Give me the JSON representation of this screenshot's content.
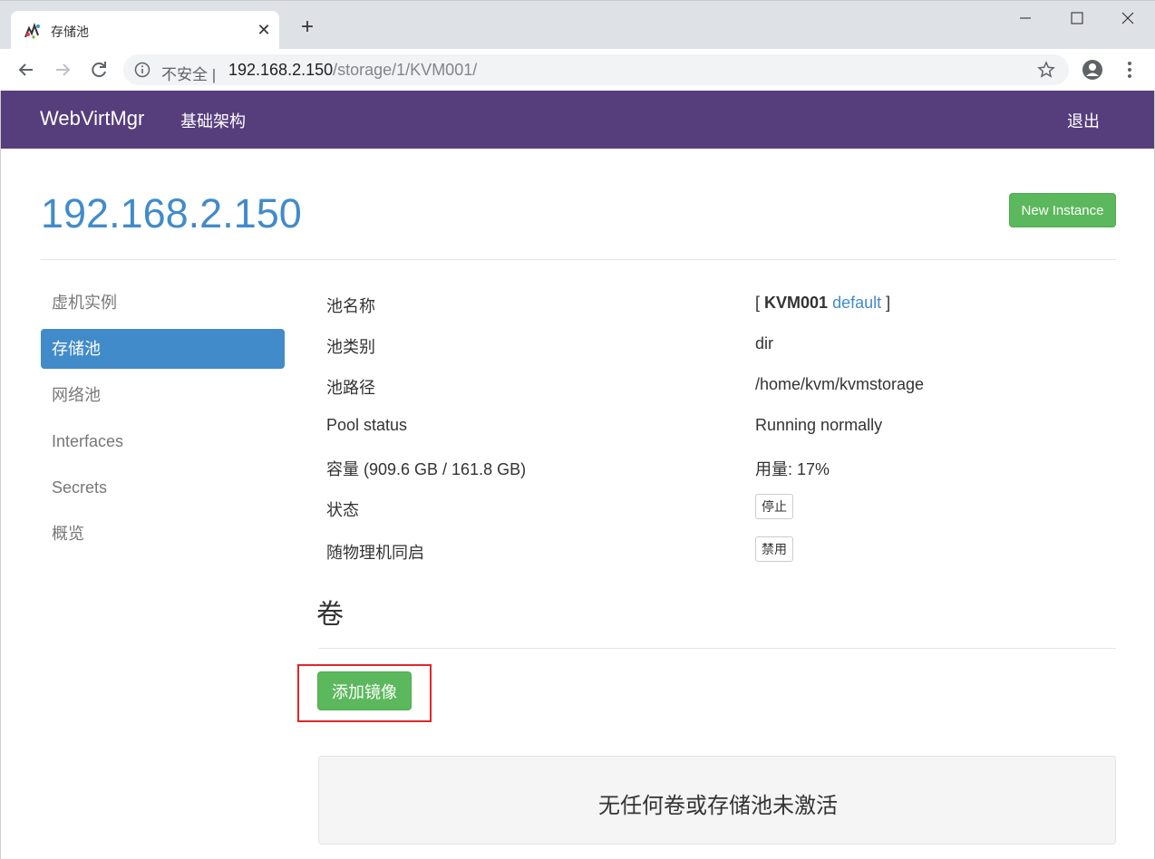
{
  "browser": {
    "tab_title": "存储池",
    "insecure_label": "不安全",
    "url_host": "192.168.2.150",
    "url_path": "/storage/1/KVM001/"
  },
  "navbar": {
    "brand": "WebVirtMgr",
    "infrastructure": "基础架构",
    "logout": "退出",
    "color": "#563d7c"
  },
  "header": {
    "host_title": "192.168.2.150",
    "new_instance_label": "New Instance"
  },
  "sidebar": {
    "items": [
      {
        "label": "虚机实例"
      },
      {
        "label": "存储池"
      },
      {
        "label": "网络池"
      },
      {
        "label": "Interfaces"
      },
      {
        "label": "Secrets"
      },
      {
        "label": "概览"
      }
    ],
    "active_item": "存储池"
  },
  "pool_info": {
    "name_label": "池名称",
    "name_open_bracket": "[",
    "name_value": "KVM001",
    "name_link": "default",
    "name_close_bracket": "]",
    "type_label": "池类别",
    "type_value": "dir",
    "path_label": "池路径",
    "path_value": "/home/kvm/kvmstorage",
    "status_label": "Pool status",
    "status_value": "Running normally",
    "capacity_label": "容量 (909.6 GB / 161.8 GB)",
    "usage_value": "用量: 17%",
    "state_label": "状态",
    "stop_button": "停止",
    "autostart_label": "随物理机同启",
    "disable_button": "禁用"
  },
  "volumes": {
    "heading": "卷",
    "add_image_button": "添加镜像",
    "empty_message": "无任何卷或存储池未激活"
  },
  "colors": {
    "primary": "#428bca",
    "success": "#5cb85c",
    "highlight": "#e0262b"
  }
}
